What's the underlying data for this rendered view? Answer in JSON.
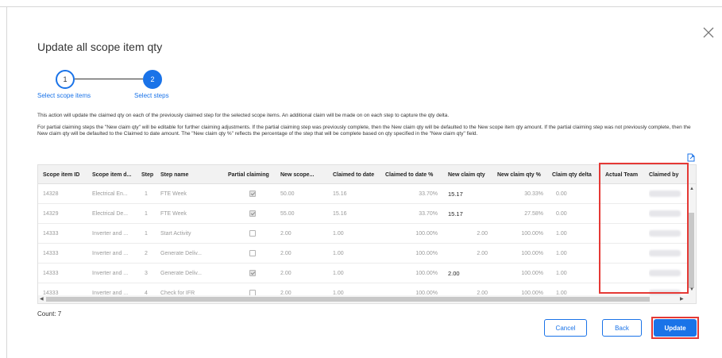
{
  "dialog": {
    "title": "Update all scope item qty",
    "steps": [
      {
        "number": "1",
        "label": "Select scope items"
      },
      {
        "number": "2",
        "label": "Select steps"
      }
    ],
    "description_1": "This action will update the claimed qty on each of the previously claimed step for the selected scope items. An additional claim will be made on on each step to capture the qty delta.",
    "description_2": "For partial claiming steps the \"New claim qty\" will be editable for further claiming adjustments. If the partial claiming step was previously complete, then the New claim qty will be defaulted to the New scope item qty amount. If the partial claiming step was not previously complete, then the New claim qty will be defaulted to the Claimed to date amount. The \"New claim qty %\" reflects the percentage of the step that will be complete based on qty specified in the \"New claim qty\" field.",
    "count_label": "Count: 7",
    "buttons": {
      "cancel": "Cancel",
      "back": "Back",
      "update": "Update"
    }
  },
  "table": {
    "columns": [
      "Scope item ID",
      "Scope item d...",
      "Step",
      "Step name",
      "Partial claiming",
      "New scope...",
      "Claimed to date",
      "Claimed to date %",
      "New claim qty",
      "New claim qty %",
      "Claim qty delta",
      "Actual Team",
      "Claimed by"
    ],
    "rows": [
      {
        "id": "14328",
        "desc": "Electrical En...",
        "step": "1",
        "name": "FTE Week",
        "partial": true,
        "new_scope": "50.00",
        "claimed": "15.16",
        "claimed_pct": "33.70%",
        "new_claim": "15.17",
        "new_claim_pct": "30.33%",
        "delta": "0.00",
        "team": "",
        "editable": true
      },
      {
        "id": "14329",
        "desc": "Electrical De...",
        "step": "1",
        "name": "FTE Week",
        "partial": true,
        "new_scope": "55.00",
        "claimed": "15.16",
        "claimed_pct": "33.70%",
        "new_claim": "15.17",
        "new_claim_pct": "27.58%",
        "delta": "0.00",
        "team": "",
        "editable": true
      },
      {
        "id": "14333",
        "desc": "Inverter and ...",
        "step": "1",
        "name": "Start Activity",
        "partial": false,
        "new_scope": "2.00",
        "claimed": "1.00",
        "claimed_pct": "100.00%",
        "new_claim": "2.00",
        "new_claim_pct": "100.00%",
        "delta": "1.00",
        "team": "",
        "editable": false
      },
      {
        "id": "14333",
        "desc": "Inverter and ...",
        "step": "2",
        "name": "Generate Deliv...",
        "partial": false,
        "new_scope": "2.00",
        "claimed": "1.00",
        "claimed_pct": "100.00%",
        "new_claim": "2.00",
        "new_claim_pct": "100.00%",
        "delta": "1.00",
        "team": "",
        "editable": false
      },
      {
        "id": "14333",
        "desc": "Inverter and ...",
        "step": "3",
        "name": "Generate Deliv...",
        "partial": true,
        "new_scope": "2.00",
        "claimed": "1.00",
        "claimed_pct": "100.00%",
        "new_claim": "2.00",
        "new_claim_pct": "100.00%",
        "delta": "1.00",
        "team": "",
        "editable": true
      },
      {
        "id": "14333",
        "desc": "Inverter and ...",
        "step": "4",
        "name": "Check for IFR",
        "partial": false,
        "new_scope": "2.00",
        "claimed": "1.00",
        "claimed_pct": "100.00%",
        "new_claim": "2.00",
        "new_claim_pct": "100.00%",
        "delta": "1.00",
        "team": "",
        "editable": false
      }
    ]
  },
  "colors": {
    "accent": "#1a73e8",
    "highlight": "#e53935",
    "header_bg": "#f2f2f2"
  },
  "icons": {
    "close": "close-icon",
    "export": "export-icon"
  }
}
